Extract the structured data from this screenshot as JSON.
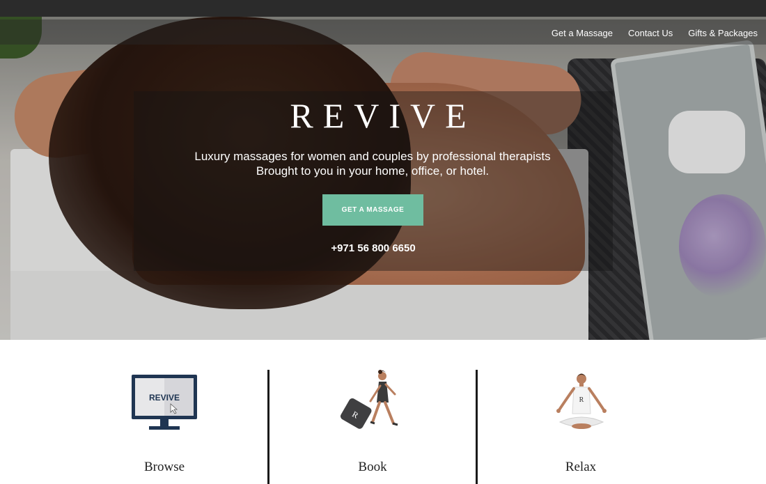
{
  "nav": {
    "items": [
      {
        "label": "Get a Massage"
      },
      {
        "label": "Contact Us"
      },
      {
        "label": "Gifts & Packages"
      }
    ]
  },
  "hero": {
    "brand": "REVIVE",
    "tagline_line1": "Luxury massages for women and couples by professional therapists",
    "tagline_line2": "Brought to you in your home, office, or hotel.",
    "cta_label": "GET A MASSAGE",
    "phone": "+971 56 800 6650"
  },
  "steps": {
    "browse": {
      "label": "Browse",
      "screen_text": "REVIVE"
    },
    "book": {
      "label": "Book",
      "bag_letter": "R"
    },
    "relax": {
      "label": "Relax",
      "shirt_letter": "R"
    }
  },
  "colors": {
    "accent": "#6fbda0",
    "topbar": "#2b2b2b",
    "monitor_frame": "#1f3552"
  }
}
